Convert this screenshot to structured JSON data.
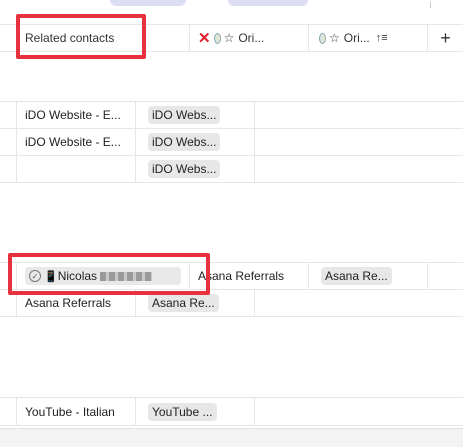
{
  "header": {
    "related_contacts": "Related contacts",
    "col_origin_1": "Ori...",
    "col_origin_2": "Ori...",
    "add_column": "+"
  },
  "icons": {
    "x": "✕",
    "star": "☆",
    "sort": "↑≡",
    "check": "✓",
    "phone": "📱"
  },
  "rows": [
    {
      "col1": "iDO Website - E...",
      "chip": "iDO Webs..."
    },
    {
      "col1": "iDO Website - E...",
      "chip": "iDO Webs..."
    },
    {
      "col1": "",
      "chip": "iDO Webs..."
    },
    {
      "contact_name": "Nicolas",
      "col3": "Asana Referrals",
      "chip4": "Asana Re..."
    },
    {
      "col1": "Asana Referrals",
      "chip": "Asana Re..."
    },
    {
      "col1": "YouTube - Italian",
      "chip": "YouTube ..."
    }
  ],
  "colors": {
    "highlight": "#e8313e",
    "chip_bg": "#e7e7e7",
    "grid_line": "#e6e6e6"
  }
}
